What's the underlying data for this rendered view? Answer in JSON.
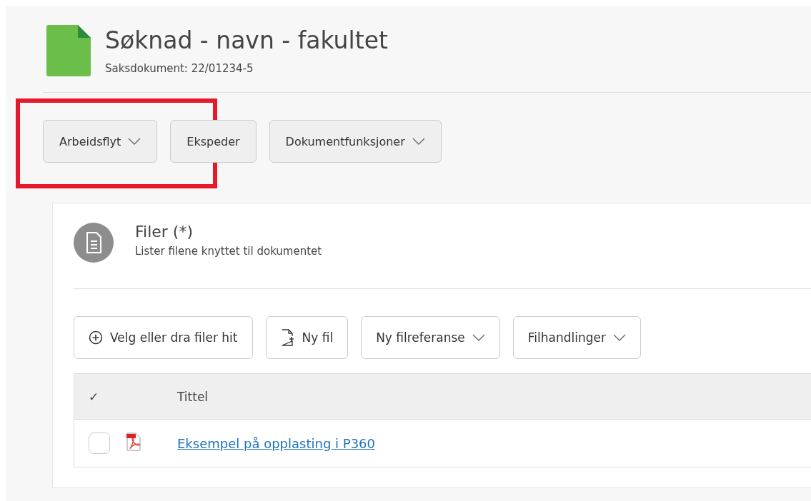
{
  "header": {
    "title": "Søknad - navn - fakultet",
    "subtitle": "Saksdokument: 22/01234-5"
  },
  "toolbar": [
    {
      "label": "Arbeidsflyt",
      "dropdown": true,
      "highlighted": true
    },
    {
      "label": "Ekspeder",
      "dropdown": false,
      "highlighted": false
    },
    {
      "label": "Dokumentfunksjoner",
      "dropdown": true,
      "highlighted": false
    }
  ],
  "files_card": {
    "title": "Filer (*)",
    "description": "Lister filene knyttet til dokumentet",
    "actions": [
      {
        "label": "Velg eller dra filer hit",
        "kind": "add"
      },
      {
        "label": "Ny fil",
        "kind": "newfile"
      },
      {
        "label": "Ny filreferanse",
        "kind": "dropdown"
      },
      {
        "label": "Filhandlinger",
        "kind": "dropdown"
      }
    ],
    "table": {
      "columns": [
        "✓",
        "Tittel"
      ],
      "rows": [
        {
          "title": "Eksempel på opplasting i P360",
          "checked": false
        }
      ]
    }
  }
}
